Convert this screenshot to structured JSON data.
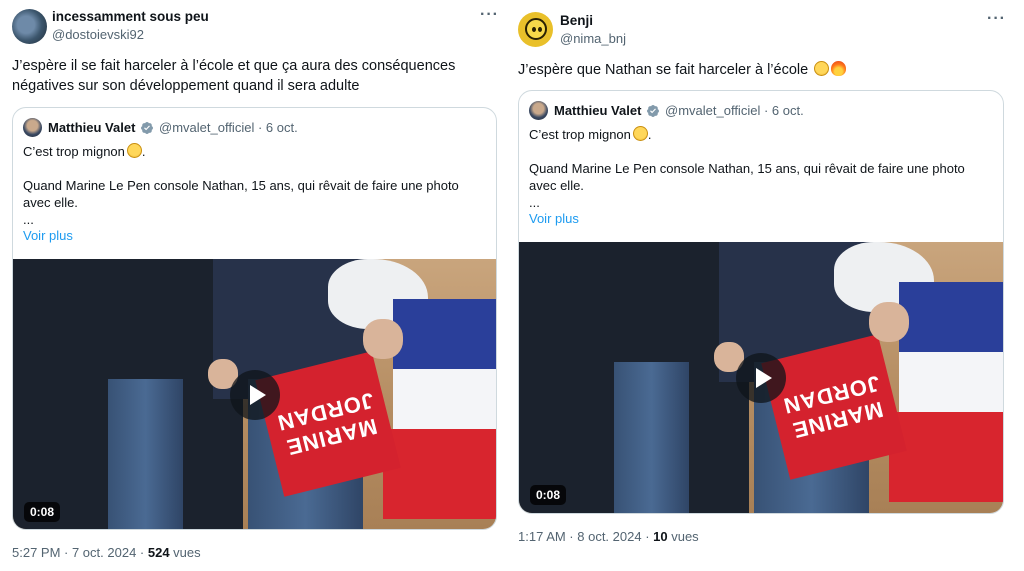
{
  "tweets": [
    {
      "author": {
        "name": "incessamment sous peu",
        "handle": "@dostoievski92"
      },
      "text": "J’espère il se fait harceler à l’école et que ça aura des conséquences négatives sur son développement quand il sera adulte",
      "quote": {
        "name": "Matthieu Valet",
        "handle_date": "@mvalet_officiel · 6 oct.",
        "line1": "C’est trop mignon",
        "line2": "Quand Marine Le Pen console Nathan, 15 ans, qui rêvait de faire une photo avec elle.",
        "ellipsis": "...",
        "see_more": "Voir plus",
        "video_duration": "0:08",
        "sign_text": "MARINE\nJORDAN"
      },
      "meta": {
        "time": "5:27 PM · 7 oct. 2024 · ",
        "views": "524",
        "views_label": " vues"
      }
    },
    {
      "author": {
        "name": "Benji",
        "handle": "@nima_bnj"
      },
      "text": "J’espère que Nathan se fait harceler à l’école",
      "quote": {
        "name": "Matthieu Valet",
        "handle_date": "@mvalet_officiel · 6 oct.",
        "line1": "C’est trop mignon",
        "line2": "Quand Marine Le Pen console Nathan, 15 ans, qui rêvait de faire une photo avec elle.",
        "ellipsis": "...",
        "see_more": "Voir plus",
        "video_duration": "0:08",
        "sign_text": "MARINE\nJORDAN"
      },
      "meta": {
        "time": "1:17 AM · 8 oct. 2024 · ",
        "views": "10",
        "views_label": " vues"
      }
    }
  ],
  "icons": [
    "more-icon",
    "verified-badge-icon",
    "play-icon",
    "pleading-face-emoji",
    "fire-emoji"
  ],
  "colors": {
    "link": "#1d9bf0",
    "secondary_text": "#536471",
    "border": "#cfd9de",
    "verified": "#829aab"
  }
}
